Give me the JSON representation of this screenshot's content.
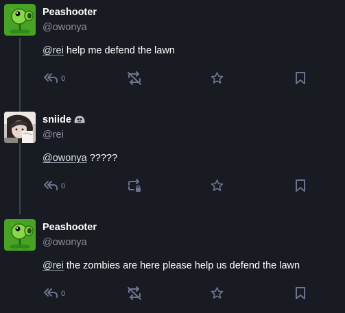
{
  "colors": {
    "background": "#191b22",
    "muted": "#8d8fa0",
    "icon": "#6f7390",
    "thread_line": "#3e4254",
    "text": "#ffffff"
  },
  "posts": [
    {
      "display_name": "Peashooter",
      "handle": "@owonya",
      "avatar": "peashooter-avatar",
      "mention": "@rei",
      "text": " help me defend the lawn",
      "reply_count": "0",
      "boost_icon": "boost-disabled-icon"
    },
    {
      "display_name": "sniide",
      "handle": "@rei",
      "avatar": "sniide-avatar",
      "badge_icon": "blob-emoji-icon",
      "mention": "@owonya",
      "text": " ?????",
      "reply_count": "0",
      "boost_icon": "boost-private-icon"
    },
    {
      "display_name": "Peashooter",
      "handle": "@owonya",
      "avatar": "peashooter-avatar",
      "mention": "@rei",
      "text": " the zombies are here please help us defend the lawn",
      "reply_count": "0",
      "boost_icon": "boost-disabled-icon"
    }
  ]
}
